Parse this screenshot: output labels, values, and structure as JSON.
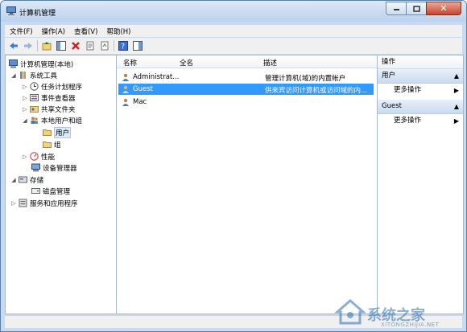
{
  "window": {
    "title": "计算机管理"
  },
  "menubar": {
    "items": [
      {
        "label": "文件(F)"
      },
      {
        "label": "操作(A)"
      },
      {
        "label": "查看(V)"
      },
      {
        "label": "帮助(H)"
      }
    ]
  },
  "tree": {
    "root": "计算机管理(本地)",
    "system_tools": "系统工具",
    "task_scheduler": "任务计划程序",
    "event_viewer": "事件查看器",
    "shared_folders": "共享文件夹",
    "local_users_groups": "本地用户和组",
    "users": "用户",
    "groups": "组",
    "performance": "性能",
    "device_manager": "设备管理器",
    "storage": "存储",
    "disk_management": "磁盘管理",
    "services_apps": "服务和应用程序"
  },
  "list": {
    "columns": {
      "name": "名称",
      "fullname": "全名",
      "description": "描述"
    },
    "rows": [
      {
        "name": "Administrat...",
        "fullname": "",
        "description": "管理计算机(域)的内置帐户"
      },
      {
        "name": "Guest",
        "fullname": "",
        "description": "供来宾访问计算机或访问域的内..."
      },
      {
        "name": "Mac",
        "fullname": "",
        "description": ""
      }
    ]
  },
  "actions": {
    "header": "操作",
    "section1": "用户",
    "section1_more": "更多操作",
    "section2": "Guest",
    "section2_more": "更多操作"
  },
  "watermark": {
    "text": "系统之家",
    "url": "XITONGZHIJIA.NET"
  },
  "colors": {
    "selection": "#3399ff",
    "window_frame": "#c9daf0"
  }
}
